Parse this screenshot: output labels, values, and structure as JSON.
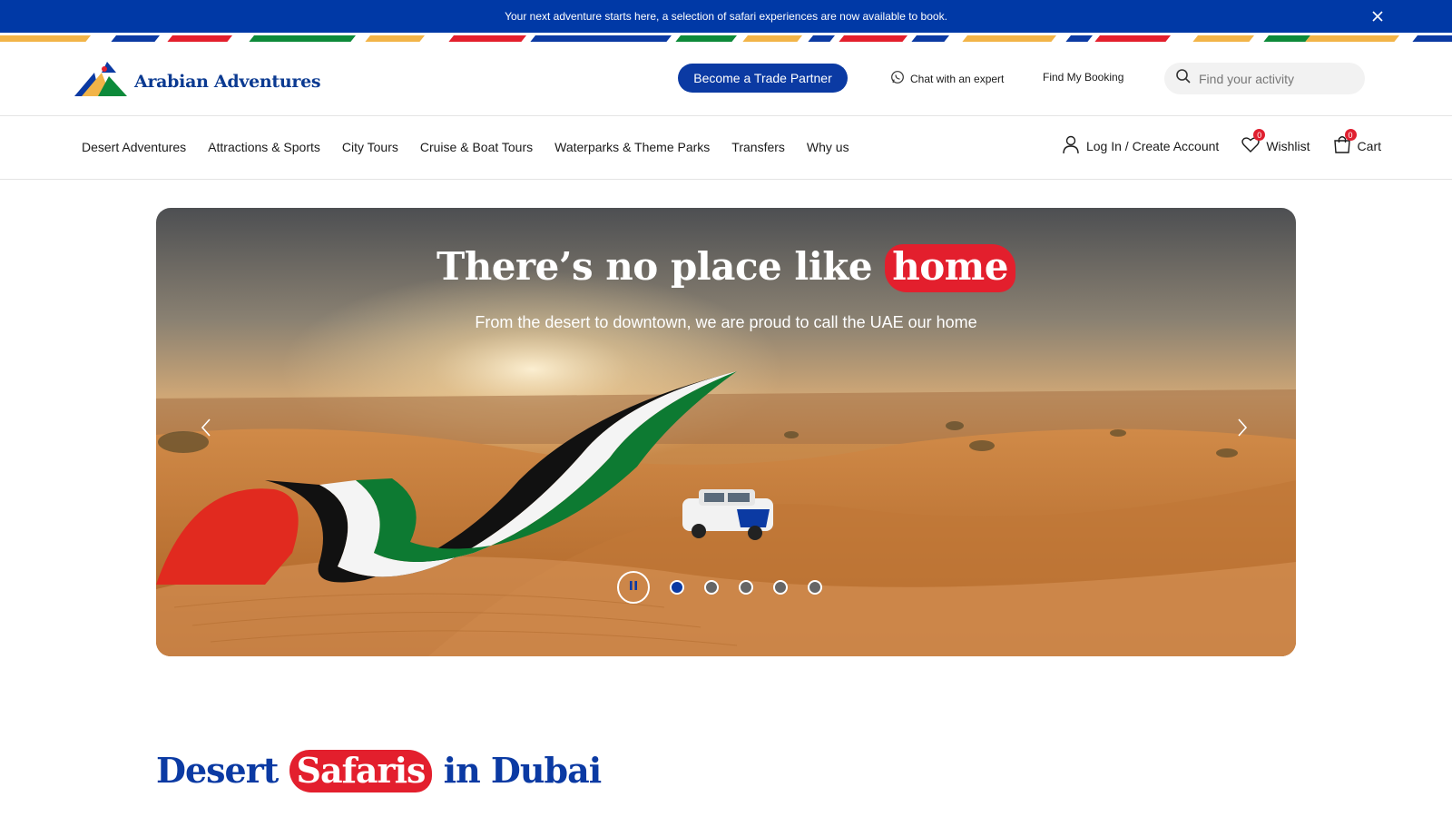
{
  "announcement": {
    "text": "Your next adventure starts here, a selection of safari experiences are now available to book."
  },
  "header": {
    "logo_text": "Arabian Adventures",
    "trade_button": "Become a Trade Partner",
    "chat_label": "Chat with an expert",
    "find_booking": "Find My Booking",
    "search_placeholder": "Find your activity"
  },
  "nav": {
    "items": [
      "Desert Adventures",
      "Attractions & Sports",
      "City Tours",
      "Cruise & Boat Tours",
      "Waterparks & Theme Parks",
      "Transfers",
      "Why us"
    ],
    "login_label": "Log In / Create Account",
    "wishlist_label": "Wishlist",
    "wishlist_count": "0",
    "cart_label": "Cart",
    "cart_count": "0"
  },
  "hero": {
    "title_prefix": "There’s no place like",
    "title_highlight": "home",
    "subtitle": "From the desert to downtown, we are proud to call the UAE our home",
    "active_slide": 1,
    "slide_count": 5
  },
  "section": {
    "title_prefix": "Desert",
    "title_highlight": "Safaris",
    "title_suffix": "in Dubai"
  },
  "colors": {
    "brand_blue": "#0b3aa3",
    "announce_blue": "#0039a6",
    "accent_red": "#e31f2d"
  }
}
